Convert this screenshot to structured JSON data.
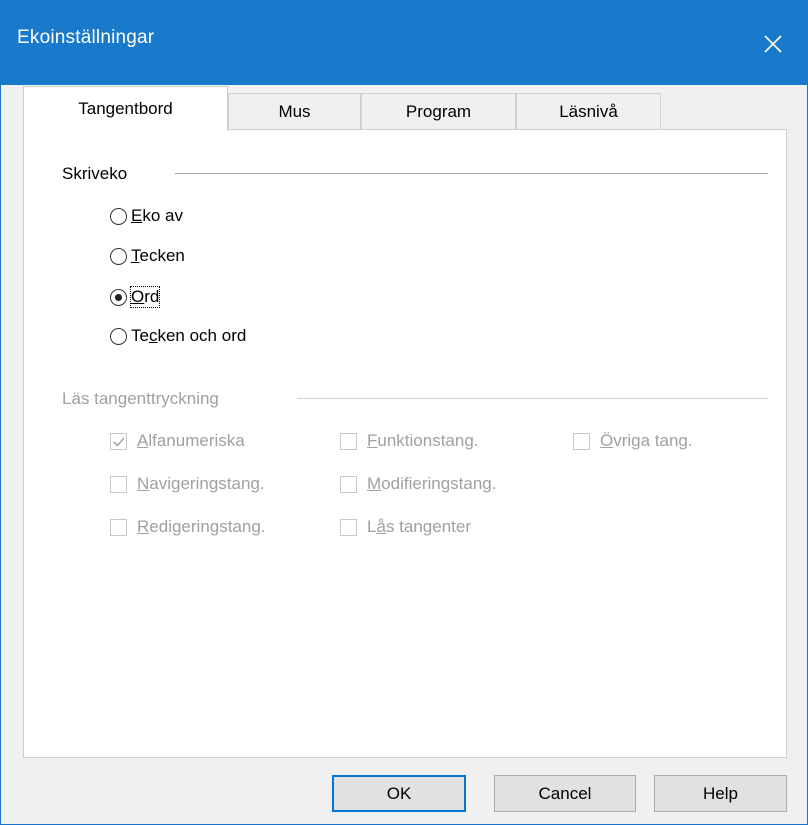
{
  "window": {
    "title": "Ekoinställningar"
  },
  "tabs": [
    {
      "label": "Tangentbord",
      "active": true
    },
    {
      "label": "Mus",
      "active": false
    },
    {
      "label": "Program",
      "active": false
    },
    {
      "label": "Läsnivå",
      "active": false
    }
  ],
  "skriveko": {
    "label": "Skriveko",
    "options": [
      {
        "mnemonic": "E",
        "rest": "ko av",
        "selected": false
      },
      {
        "mnemonic": "T",
        "rest": "ecken",
        "selected": false
      },
      {
        "mnemonic": "O",
        "rest": "rd",
        "selected": true
      },
      {
        "pre": "Te",
        "mnemonic": "c",
        "rest": "ken och ord",
        "selected": false
      }
    ]
  },
  "las_tangenttryckning": {
    "label": "Läs tangenttryckning",
    "enabled": false,
    "checkboxes": [
      {
        "mnemonic": "A",
        "rest": "lfanumeriska",
        "checked": true
      },
      {
        "mnemonic": "F",
        "rest": "unktionstang.",
        "checked": false
      },
      {
        "mnemonic": "Ö",
        "rest": "vriga tang.",
        "checked": false
      },
      {
        "mnemonic": "N",
        "rest": "avigeringstang.",
        "checked": false
      },
      {
        "mnemonic": "M",
        "rest": "odifieringstang.",
        "checked": false
      },
      {
        "mnemonic": "R",
        "rest": "edigeringstang.",
        "checked": false
      },
      {
        "pre": "L",
        "mnemonic": "å",
        "rest": "s tangenter",
        "checked": false
      }
    ]
  },
  "buttons": {
    "ok": "OK",
    "cancel": "Cancel",
    "help": "Help"
  },
  "colors": {
    "titlebar": "#1979ca",
    "disabled_text": "#a0a0a0",
    "default_button_border": "#0078d7"
  },
  "icons": {
    "close": "close-icon",
    "checkmark": "checkmark-icon"
  }
}
